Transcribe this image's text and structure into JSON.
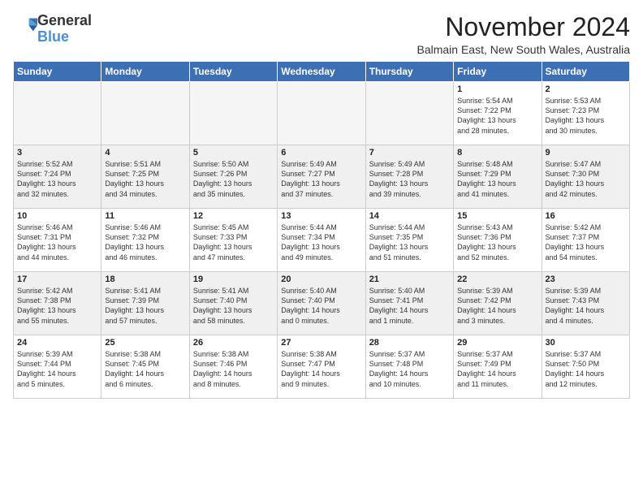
{
  "logo": {
    "general": "General",
    "blue": "Blue"
  },
  "header": {
    "month_title": "November 2024",
    "location": "Balmain East, New South Wales, Australia"
  },
  "days_of_week": [
    "Sunday",
    "Monday",
    "Tuesday",
    "Wednesday",
    "Thursday",
    "Friday",
    "Saturday"
  ],
  "weeks": [
    {
      "shaded": false,
      "days": [
        {
          "num": "",
          "info": ""
        },
        {
          "num": "",
          "info": ""
        },
        {
          "num": "",
          "info": ""
        },
        {
          "num": "",
          "info": ""
        },
        {
          "num": "",
          "info": ""
        },
        {
          "num": "1",
          "info": "Sunrise: 5:54 AM\nSunset: 7:22 PM\nDaylight: 13 hours\nand 28 minutes."
        },
        {
          "num": "2",
          "info": "Sunrise: 5:53 AM\nSunset: 7:23 PM\nDaylight: 13 hours\nand 30 minutes."
        }
      ]
    },
    {
      "shaded": true,
      "days": [
        {
          "num": "3",
          "info": "Sunrise: 5:52 AM\nSunset: 7:24 PM\nDaylight: 13 hours\nand 32 minutes."
        },
        {
          "num": "4",
          "info": "Sunrise: 5:51 AM\nSunset: 7:25 PM\nDaylight: 13 hours\nand 34 minutes."
        },
        {
          "num": "5",
          "info": "Sunrise: 5:50 AM\nSunset: 7:26 PM\nDaylight: 13 hours\nand 35 minutes."
        },
        {
          "num": "6",
          "info": "Sunrise: 5:49 AM\nSunset: 7:27 PM\nDaylight: 13 hours\nand 37 minutes."
        },
        {
          "num": "7",
          "info": "Sunrise: 5:49 AM\nSunset: 7:28 PM\nDaylight: 13 hours\nand 39 minutes."
        },
        {
          "num": "8",
          "info": "Sunrise: 5:48 AM\nSunset: 7:29 PM\nDaylight: 13 hours\nand 41 minutes."
        },
        {
          "num": "9",
          "info": "Sunrise: 5:47 AM\nSunset: 7:30 PM\nDaylight: 13 hours\nand 42 minutes."
        }
      ]
    },
    {
      "shaded": false,
      "days": [
        {
          "num": "10",
          "info": "Sunrise: 5:46 AM\nSunset: 7:31 PM\nDaylight: 13 hours\nand 44 minutes."
        },
        {
          "num": "11",
          "info": "Sunrise: 5:46 AM\nSunset: 7:32 PM\nDaylight: 13 hours\nand 46 minutes."
        },
        {
          "num": "12",
          "info": "Sunrise: 5:45 AM\nSunset: 7:33 PM\nDaylight: 13 hours\nand 47 minutes."
        },
        {
          "num": "13",
          "info": "Sunrise: 5:44 AM\nSunset: 7:34 PM\nDaylight: 13 hours\nand 49 minutes."
        },
        {
          "num": "14",
          "info": "Sunrise: 5:44 AM\nSunset: 7:35 PM\nDaylight: 13 hours\nand 51 minutes."
        },
        {
          "num": "15",
          "info": "Sunrise: 5:43 AM\nSunset: 7:36 PM\nDaylight: 13 hours\nand 52 minutes."
        },
        {
          "num": "16",
          "info": "Sunrise: 5:42 AM\nSunset: 7:37 PM\nDaylight: 13 hours\nand 54 minutes."
        }
      ]
    },
    {
      "shaded": true,
      "days": [
        {
          "num": "17",
          "info": "Sunrise: 5:42 AM\nSunset: 7:38 PM\nDaylight: 13 hours\nand 55 minutes."
        },
        {
          "num": "18",
          "info": "Sunrise: 5:41 AM\nSunset: 7:39 PM\nDaylight: 13 hours\nand 57 minutes."
        },
        {
          "num": "19",
          "info": "Sunrise: 5:41 AM\nSunset: 7:40 PM\nDaylight: 13 hours\nand 58 minutes."
        },
        {
          "num": "20",
          "info": "Sunrise: 5:40 AM\nSunset: 7:40 PM\nDaylight: 14 hours\nand 0 minutes."
        },
        {
          "num": "21",
          "info": "Sunrise: 5:40 AM\nSunset: 7:41 PM\nDaylight: 14 hours\nand 1 minute."
        },
        {
          "num": "22",
          "info": "Sunrise: 5:39 AM\nSunset: 7:42 PM\nDaylight: 14 hours\nand 3 minutes."
        },
        {
          "num": "23",
          "info": "Sunrise: 5:39 AM\nSunset: 7:43 PM\nDaylight: 14 hours\nand 4 minutes."
        }
      ]
    },
    {
      "shaded": false,
      "days": [
        {
          "num": "24",
          "info": "Sunrise: 5:39 AM\nSunset: 7:44 PM\nDaylight: 14 hours\nand 5 minutes."
        },
        {
          "num": "25",
          "info": "Sunrise: 5:38 AM\nSunset: 7:45 PM\nDaylight: 14 hours\nand 6 minutes."
        },
        {
          "num": "26",
          "info": "Sunrise: 5:38 AM\nSunset: 7:46 PM\nDaylight: 14 hours\nand 8 minutes."
        },
        {
          "num": "27",
          "info": "Sunrise: 5:38 AM\nSunset: 7:47 PM\nDaylight: 14 hours\nand 9 minutes."
        },
        {
          "num": "28",
          "info": "Sunrise: 5:37 AM\nSunset: 7:48 PM\nDaylight: 14 hours\nand 10 minutes."
        },
        {
          "num": "29",
          "info": "Sunrise: 5:37 AM\nSunset: 7:49 PM\nDaylight: 14 hours\nand 11 minutes."
        },
        {
          "num": "30",
          "info": "Sunrise: 5:37 AM\nSunset: 7:50 PM\nDaylight: 14 hours\nand 12 minutes."
        }
      ]
    }
  ]
}
